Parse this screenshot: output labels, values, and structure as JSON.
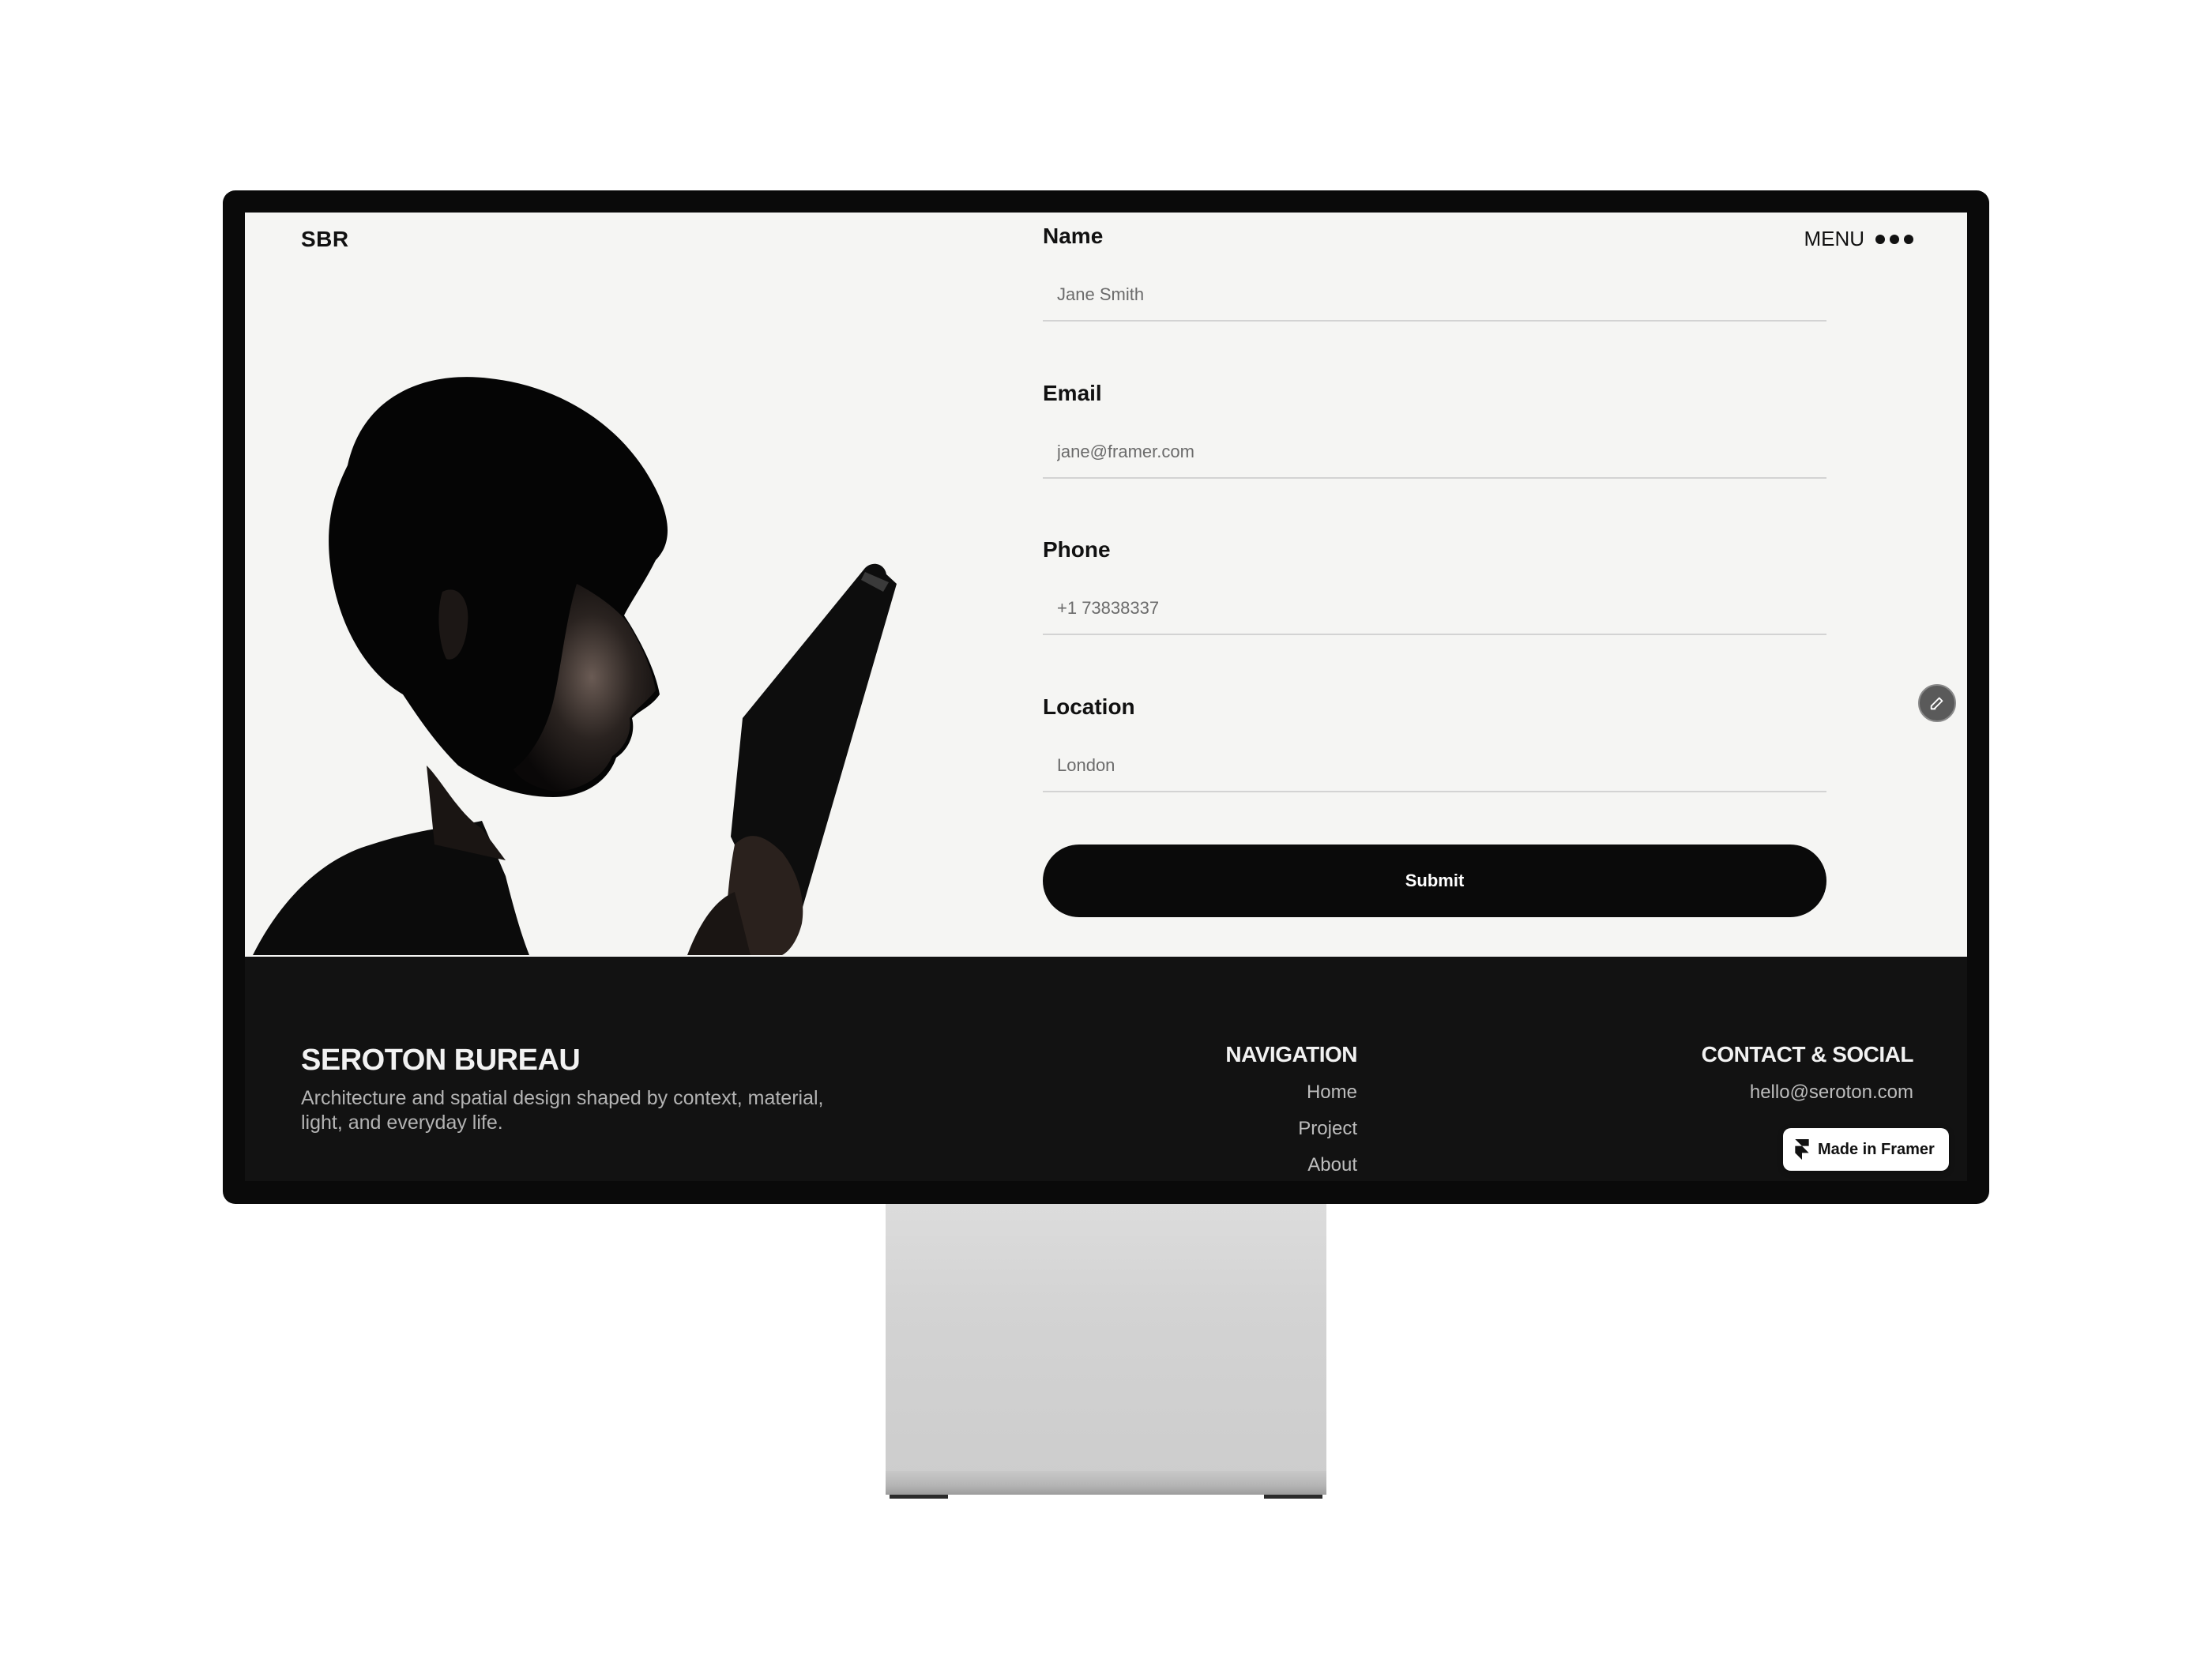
{
  "header": {
    "logo": "SBR",
    "menu_label": "MENU"
  },
  "form": {
    "fields": [
      {
        "label": "Name",
        "placeholder": "Jane Smith"
      },
      {
        "label": "Email",
        "placeholder": "jane@framer.com"
      },
      {
        "label": "Phone",
        "placeholder": "+1 73838337"
      },
      {
        "label": "Location",
        "placeholder": "London"
      }
    ],
    "submit_label": "Submit"
  },
  "footer": {
    "brand": "SEROTON BUREAU",
    "tagline": "Architecture and spatial design shaped by context, material, light, and everyday life.",
    "navigation": {
      "title": "NAVIGATION",
      "links": [
        "Home",
        "Project",
        "About"
      ]
    },
    "contact": {
      "title": "CONTACT & SOCIAL",
      "links": [
        "hello@seroton.com"
      ]
    }
  },
  "badge": {
    "label": "Made in Framer"
  },
  "icons": {
    "menu": "more-horizontal-icon",
    "edit": "pencil-icon",
    "framer": "framer-logo-icon"
  },
  "colors": {
    "screen_bg": "#f5f5f3",
    "footer_bg": "#121212",
    "button_bg": "#0a0a0a",
    "text": "#111111"
  }
}
